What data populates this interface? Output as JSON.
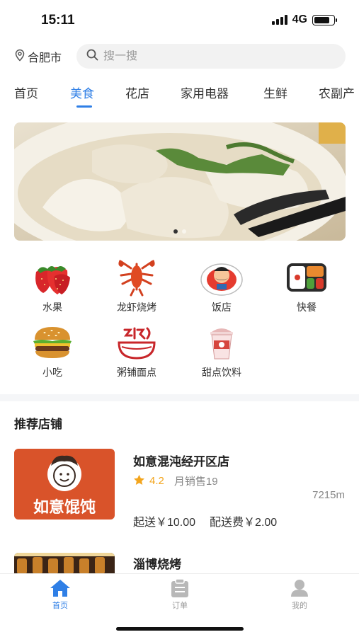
{
  "status_bar": {
    "time": "15:11",
    "network": "4G",
    "battery_level": 0.8,
    "signal_bars": 4
  },
  "header": {
    "city": "合肥市",
    "city_icon": "location-pin-icon",
    "search_placeholder": "搜一搜",
    "search_icon": "search-icon"
  },
  "tabs": [
    {
      "label": "首页",
      "active": false
    },
    {
      "label": "美食",
      "active": true
    },
    {
      "label": "花店",
      "active": false
    },
    {
      "label": "家用电器",
      "active": false
    },
    {
      "label": "生鲜",
      "active": false
    },
    {
      "label": "农副产",
      "active": false
    }
  ],
  "banner": {
    "image": "dumpling-soup-photo",
    "slide_count": 2,
    "current_slide": 1
  },
  "categories": [
    {
      "label": "水果",
      "icon": "strawberry-icon"
    },
    {
      "label": "龙虾烧烤",
      "icon": "lobster-icon"
    },
    {
      "label": "饭店",
      "icon": "chef-plate-icon"
    },
    {
      "label": "快餐",
      "icon": "bento-box-icon"
    },
    {
      "label": "小吃",
      "icon": "burger-icon"
    },
    {
      "label": "粥铺面点",
      "icon": "porridge-bowl-icon"
    },
    {
      "label": "甜点饮料",
      "icon": "milk-tea-icon"
    }
  ],
  "section_title": "推荐店铺",
  "stores": [
    {
      "name": "如意混沌经开区店",
      "rating": "4.2",
      "sales": "月销售19",
      "distance": "7215m",
      "min_order": "起送￥10.00",
      "delivery_fee": "配送费￥2.00",
      "logo_text": "如意馄饨",
      "logo_color": "#d9532a"
    },
    {
      "name": "淄博烧烤",
      "image": "bbq-photo"
    }
  ],
  "bottom_nav": [
    {
      "label": "首页",
      "icon": "home-icon",
      "active": true
    },
    {
      "label": "订单",
      "icon": "clipboard-icon",
      "active": false
    },
    {
      "label": "我的",
      "icon": "user-icon",
      "active": false
    }
  ],
  "colors": {
    "accent": "#2f7fe6",
    "rating": "#f3a51d",
    "inactive_nav": "#999999"
  }
}
